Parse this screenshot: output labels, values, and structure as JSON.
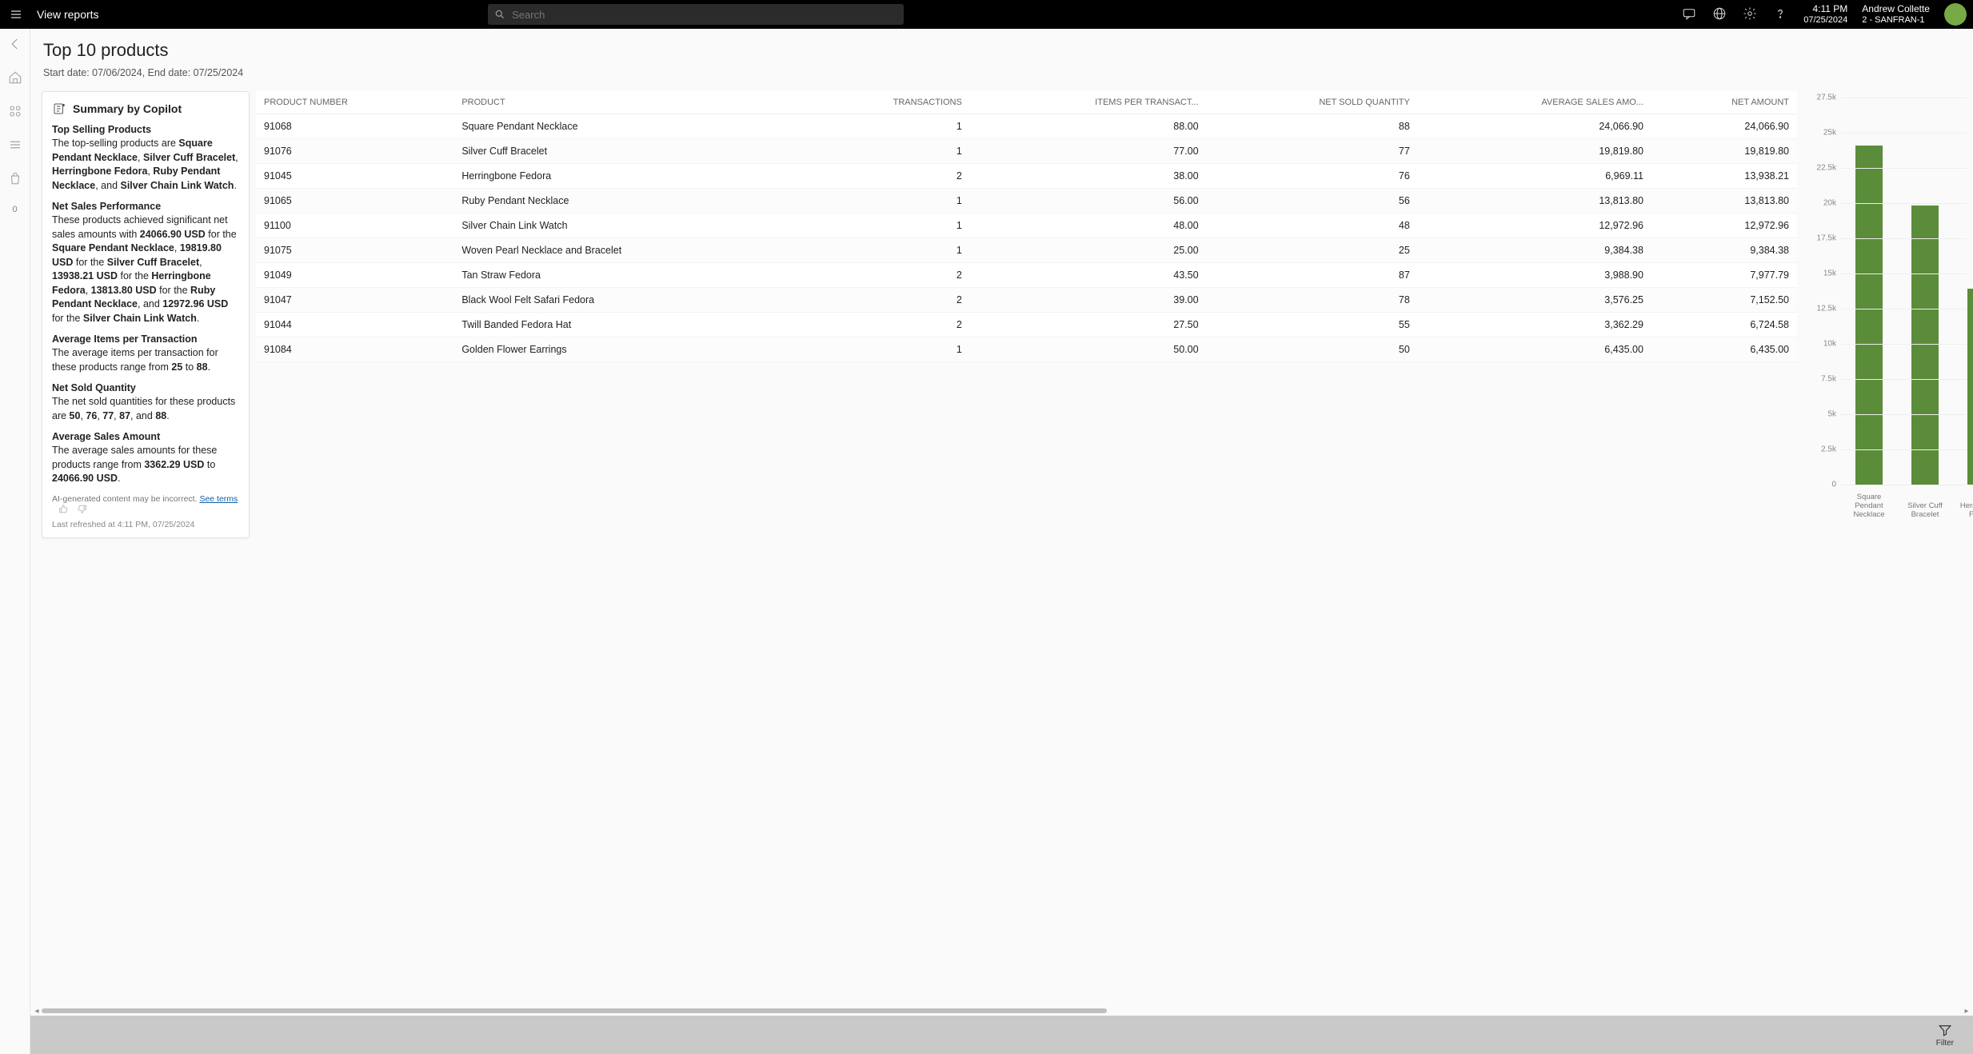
{
  "titlebar": {
    "title": "View reports",
    "search_placeholder": "Search",
    "time": "4:11 PM",
    "date": "07/25/2024",
    "user_name": "Andrew Collette",
    "user_sub": "2 - SANFRAN-1"
  },
  "rail": {
    "last_number": "0"
  },
  "page": {
    "title": "Top 10 products",
    "daterange": "Start date: 07/06/2024, End date: 07/25/2024"
  },
  "copilot": {
    "heading": "Summary by Copilot",
    "sections": {
      "top_selling_title": "Top Selling Products",
      "top_selling_body": "The top-selling products are <b>Square Pendant Necklace</b>, <b>Silver Cuff Bracelet</b>, <b>Herringbone Fedora</b>, <b>Ruby Pendant Necklace</b>, and <b>Silver Chain Link Watch</b>.",
      "net_sales_title": "Net Sales Performance",
      "net_sales_body": "These products achieved significant net sales amounts with <b>24066.90 USD</b> for the <b>Square Pendant Necklace</b>, <b>19819.80 USD</b> for the <b>Silver Cuff Bracelet</b>, <b>13938.21 USD</b> for the <b>Herringbone Fedora</b>, <b>13813.80 USD</b> for the <b>Ruby Pendant Necklace</b>, and <b>12972.96 USD</b> for the <b>Silver Chain Link Watch</b>.",
      "avg_items_title": "Average Items per Transaction",
      "avg_items_body": "The average items per transaction for these products range from <b>25</b> to <b>88</b>.",
      "net_qty_title": "Net Sold Quantity",
      "net_qty_body": "The net sold quantities for these products are <b>50</b>, <b>76</b>, <b>77</b>, <b>87</b>, and <b>88</b>.",
      "avg_sales_title": "Average Sales Amount",
      "avg_sales_body": "The average sales amounts for these products range from <b>3362.29 USD</b> to <b>24066.90 USD</b>."
    },
    "disclaimer": "AI-generated content may be incorrect.",
    "see_terms": "See terms",
    "refreshed": "Last refreshed at 4:11 PM, 07/25/2024"
  },
  "table": {
    "columns": [
      "PRODUCT NUMBER",
      "PRODUCT",
      "TRANSACTIONS",
      "ITEMS PER TRANSACT...",
      "NET SOLD QUANTITY",
      "AVERAGE SALES AMO...",
      "NET AMOUNT"
    ],
    "rows": [
      {
        "number": "91068",
        "product": "Square Pendant Necklace",
        "trx": "1",
        "ipt": "88.00",
        "qty": "88",
        "avg": "24,066.90",
        "net": "24,066.90"
      },
      {
        "number": "91076",
        "product": "Silver Cuff Bracelet",
        "trx": "1",
        "ipt": "77.00",
        "qty": "77",
        "avg": "19,819.80",
        "net": "19,819.80"
      },
      {
        "number": "91045",
        "product": "Herringbone Fedora",
        "trx": "2",
        "ipt": "38.00",
        "qty": "76",
        "avg": "6,969.11",
        "net": "13,938.21"
      },
      {
        "number": "91065",
        "product": "Ruby Pendant Necklace",
        "trx": "1",
        "ipt": "56.00",
        "qty": "56",
        "avg": "13,813.80",
        "net": "13,813.80"
      },
      {
        "number": "91100",
        "product": "Silver Chain Link Watch",
        "trx": "1",
        "ipt": "48.00",
        "qty": "48",
        "avg": "12,972.96",
        "net": "12,972.96"
      },
      {
        "number": "91075",
        "product": "Woven Pearl Necklace and Bracelet",
        "trx": "1",
        "ipt": "25.00",
        "qty": "25",
        "avg": "9,384.38",
        "net": "9,384.38"
      },
      {
        "number": "91049",
        "product": "Tan Straw Fedora",
        "trx": "2",
        "ipt": "43.50",
        "qty": "87",
        "avg": "3,988.90",
        "net": "7,977.79"
      },
      {
        "number": "91047",
        "product": "Black Wool Felt Safari Fedora",
        "trx": "2",
        "ipt": "39.00",
        "qty": "78",
        "avg": "3,576.25",
        "net": "7,152.50"
      },
      {
        "number": "91044",
        "product": "Twill Banded Fedora Hat",
        "trx": "2",
        "ipt": "27.50",
        "qty": "55",
        "avg": "3,362.29",
        "net": "6,724.58"
      },
      {
        "number": "91084",
        "product": "Golden Flower Earrings",
        "trx": "1",
        "ipt": "50.00",
        "qty": "50",
        "avg": "6,435.00",
        "net": "6,435.00"
      }
    ]
  },
  "bottom": {
    "filter_label": "Filter"
  },
  "chart_data": {
    "type": "bar",
    "categories": [
      "Square Pendant Necklace",
      "Silver Cuff Bracelet",
      "Herringbone Fedora"
    ],
    "values": [
      24066.9,
      19819.8,
      13938.21
    ],
    "ylim": [
      0,
      27500
    ],
    "yticks": [
      0,
      2500,
      5000,
      7500,
      10000,
      12500,
      15000,
      17500,
      20000,
      22500,
      25000,
      27500
    ],
    "ytick_labels": [
      "0",
      "2.5k",
      "5k",
      "7.5k",
      "10k",
      "12.5k",
      "15k",
      "17.5k",
      "20k",
      "22.5k",
      "25k",
      "27.5k"
    ],
    "bar_color": "#5b8c3a",
    "note": "Only two bars and partial third are visible in the cropped panel; remaining products are off-screen to the right."
  }
}
